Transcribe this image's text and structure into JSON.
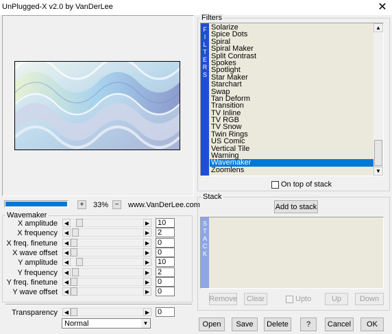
{
  "window": {
    "title": "UnPlugged-X v2.0 by VanDerLee",
    "close_glyph": "✕"
  },
  "preview": {
    "zoom_label": "33%",
    "plus_label": "+",
    "minus_label": "−",
    "site_label": "www.VanDerLee.com",
    "progress": 1.0,
    "progress_color": "#0078d7"
  },
  "filters": {
    "group_label": "Filters",
    "strip_letters": [
      "F",
      "I",
      "L",
      "T",
      "E",
      "R",
      "S"
    ],
    "strip_color": "#1f4fd1",
    "items": [
      "Solarize",
      "Spice Dots",
      "Spiral",
      "Spiral Maker",
      "Split Contrast",
      "Spokes",
      "Spotlight",
      "Star Maker",
      "Starchart",
      "Swap",
      "Tan Deform",
      "Transition",
      "TV Inline",
      "TV RGB",
      "TV Snow",
      "Twin Rings",
      "US Comic",
      "Vertical Tile",
      "Warning",
      "Wavemaker",
      "Zoomlens"
    ],
    "selected_index": 19,
    "on_top_label": "On top of stack",
    "on_top_checked": false
  },
  "stack": {
    "group_label": "Stack",
    "add_button": "Add to stack",
    "strip_letters": [
      "S",
      "T",
      "A",
      "C",
      "K"
    ],
    "strip_color": "#8ea6e4",
    "remove_button": "Remove",
    "clear_button": "Clear",
    "upto_label": "Upto",
    "up_button": "Up",
    "down_button": "Down"
  },
  "wavemaker": {
    "group_label": "Wavemaker",
    "params": [
      {
        "label": "X amplitude",
        "value": "10",
        "level": 0.08
      },
      {
        "label": "X frequency",
        "value": "2",
        "level": 0.02
      },
      {
        "label": "X freq. finetune",
        "value": "0",
        "level": 0.0
      },
      {
        "label": "X wave offset",
        "value": "0",
        "level": 0.0
      },
      {
        "label": "Y amplitude",
        "value": "10",
        "level": 0.08
      },
      {
        "label": "Y frequency",
        "value": "2",
        "level": 0.02
      },
      {
        "label": "Y freq. finetune",
        "value": "0",
        "level": 0.0
      },
      {
        "label": "Y wave offset",
        "value": "0",
        "level": 0.0
      }
    ],
    "transparency_label": "Transparency",
    "transparency_value": "0",
    "blend_mode": "Normal"
  },
  "buttons": {
    "open": "Open",
    "save": "Save",
    "delete": "Delete",
    "help": "?",
    "cancel": "Cancel",
    "ok": "OK"
  }
}
